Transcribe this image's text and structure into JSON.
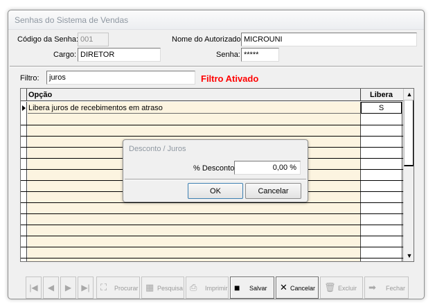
{
  "window": {
    "title": "Senhas do Sistema de Vendas"
  },
  "form": {
    "codigo_label": "Código da Senha:",
    "codigo_value": "001",
    "nome_label": "Nome do Autorizado:",
    "nome_value": "MICROUNI",
    "cargo_label": "Cargo:",
    "cargo_value": "DIRETOR",
    "senha_label": "Senha:",
    "senha_value": "*****"
  },
  "filter": {
    "label": "Filtro:",
    "value": "juros",
    "status": "Filtro Ativado"
  },
  "grid": {
    "col_opcao": "Opção",
    "col_libera": "Libera",
    "rows": [
      {
        "opcao": "Libera juros de recebimentos em atraso",
        "libera": "S"
      }
    ]
  },
  "dialog": {
    "title": "Desconto / Juros",
    "desconto_label": "% Desconto",
    "desconto_value": "0,00 %",
    "ok_label": "OK",
    "cancel_label": "Cancelar"
  },
  "toolbar": {
    "procurar": "Procurar",
    "pesquisa": "Pesquisa",
    "imprimir": "Imprimir",
    "salvar": "Salvar",
    "cancelar": "Cancelar",
    "excluir": "Excluir",
    "fechar": "Fechar"
  },
  "colors": {
    "filter_active": "#ff0000",
    "grid_row_bg": "#fcf4e0"
  },
  "icons": [
    "first-record-icon",
    "prev-record-icon",
    "next-record-icon",
    "last-record-icon",
    "binoculars-icon",
    "grid-icon",
    "printer-icon",
    "floppy-disk-icon",
    "x-icon",
    "trash-icon",
    "exit-icon"
  ]
}
